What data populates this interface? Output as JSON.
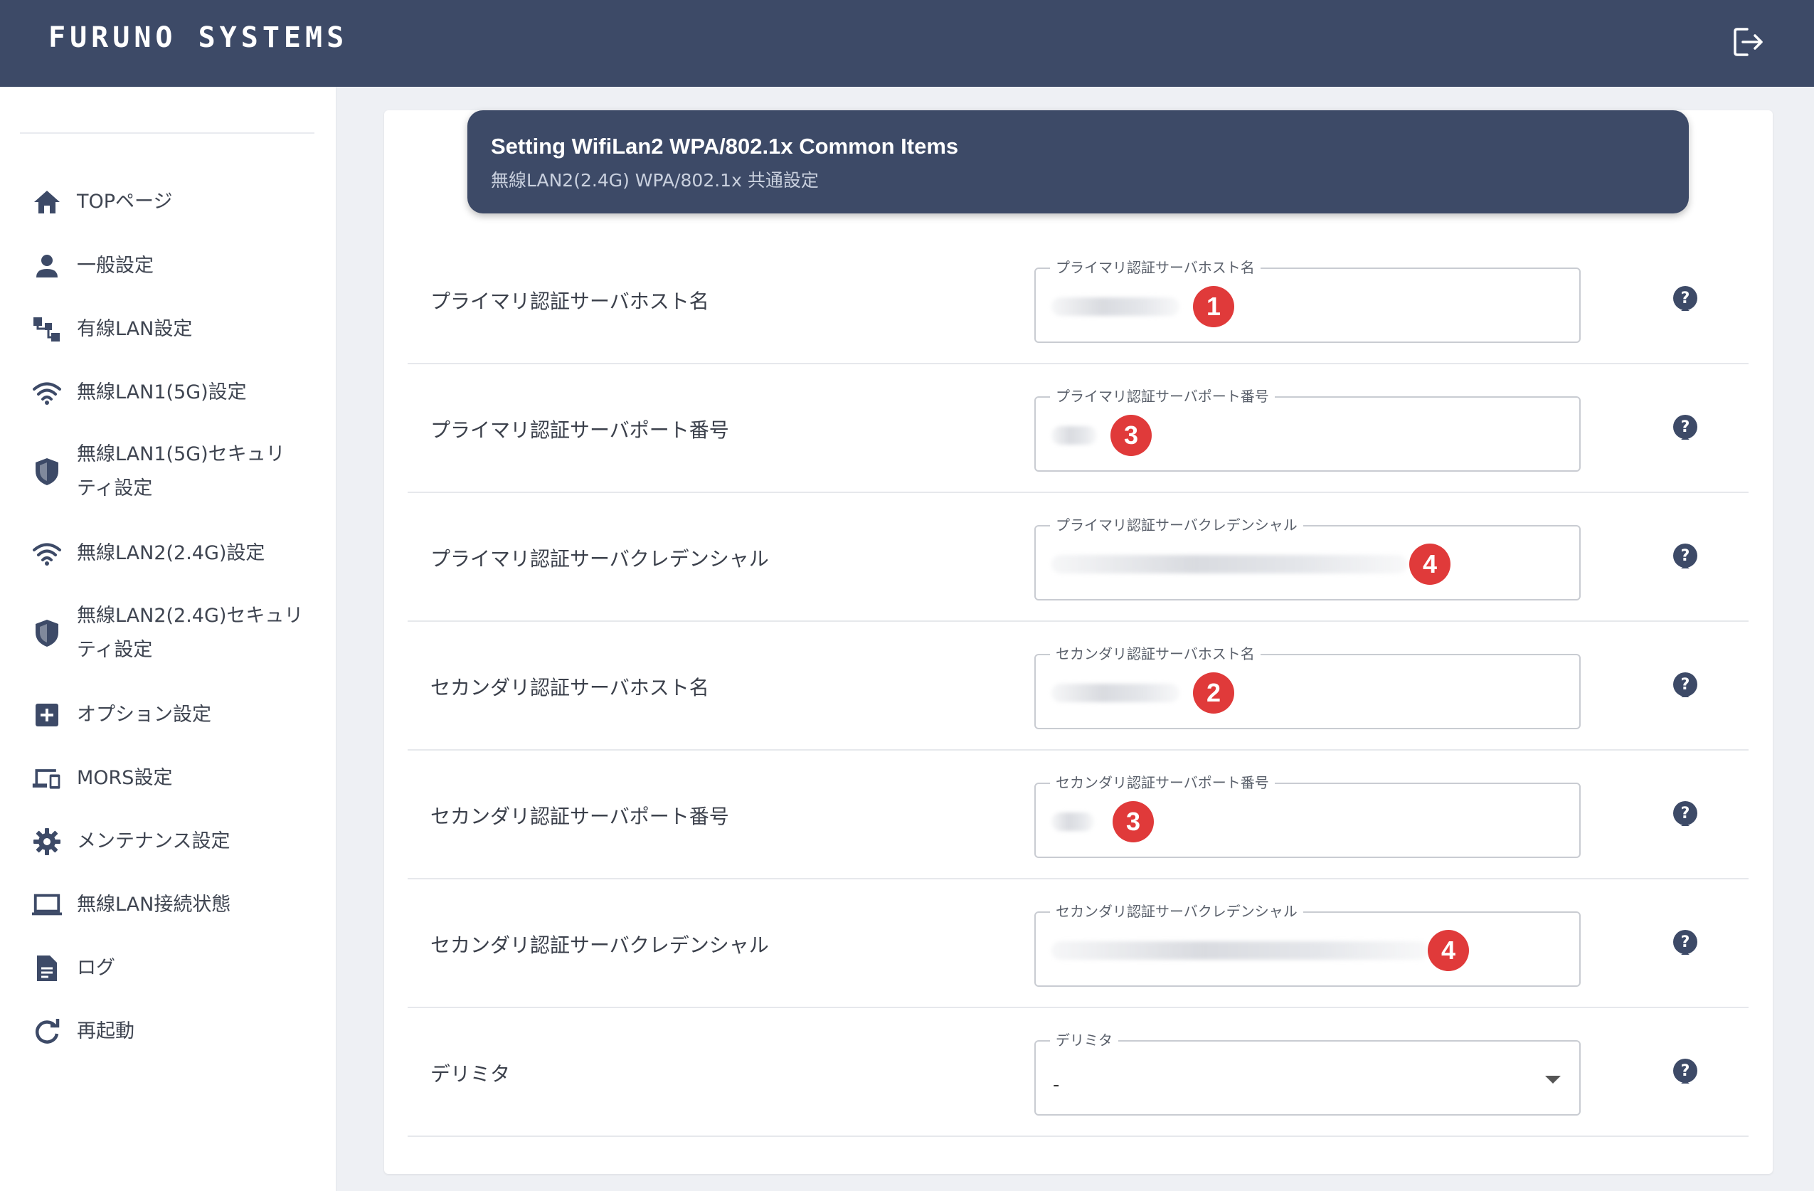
{
  "app": {
    "brand": "FURUNO SYSTEMS",
    "logout_icon": "logout-icon"
  },
  "sidebar": {
    "items": [
      {
        "label": "TOPページ",
        "icon": "home-icon"
      },
      {
        "label": "一般設定",
        "icon": "person-icon"
      },
      {
        "label": "有線LAN設定",
        "icon": "network-tree-icon"
      },
      {
        "label": "無線LAN1(5G)設定",
        "icon": "wifi-icon"
      },
      {
        "label": "無線LAN1(5G)セキュリ\nティ設定",
        "icon": "shield-icon"
      },
      {
        "label": "無線LAN2(2.4G)設定",
        "icon": "wifi-icon"
      },
      {
        "label": "無線LAN2(2.4G)セキュリ\nティ設定",
        "icon": "shield-icon"
      },
      {
        "label": "オプション設定",
        "icon": "plus-box-icon"
      },
      {
        "label": "MORS設定",
        "icon": "devices-icon"
      },
      {
        "label": "メンテナンス設定",
        "icon": "gear-icon"
      },
      {
        "label": "無線LAN接続状態",
        "icon": "laptop-icon"
      },
      {
        "label": "ログ",
        "icon": "document-icon"
      },
      {
        "label": "再起動",
        "icon": "refresh-icon"
      }
    ]
  },
  "header": {
    "title": "Setting WifiLan2 WPA/802.1x Common Items",
    "subtitle": "無線LAN2(2.4G) WPA/802.1x 共通設定"
  },
  "rows": [
    {
      "label": "プライマリ認証サーバホスト名",
      "legend": "プライマリ認証サーバホスト名",
      "badge": "1"
    },
    {
      "label": "プライマリ認証サーバポート番号",
      "legend": "プライマリ認証サーバポート番号",
      "badge": "3"
    },
    {
      "label": "プライマリ認証サーバクレデンシャル",
      "legend": "プライマリ認証サーバクレデンシャル",
      "badge": "4"
    },
    {
      "label": "セカンダリ認証サーバホスト名",
      "legend": "セカンダリ認証サーバホスト名",
      "badge": "2"
    },
    {
      "label": "セカンダリ認証サーバポート番号",
      "legend": "セカンダリ認証サーバポート番号",
      "badge": "3"
    },
    {
      "label": "セカンダリ認証サーバクレデンシャル",
      "legend": "セカンダリ認証サーバクレデンシャル",
      "badge": "4"
    },
    {
      "label": "デリミタ",
      "legend": "デリミタ",
      "value": "-"
    }
  ],
  "colors": {
    "topbar": "#3d4a67",
    "badge": "#e03a3a",
    "icon": "#3d4a67"
  }
}
